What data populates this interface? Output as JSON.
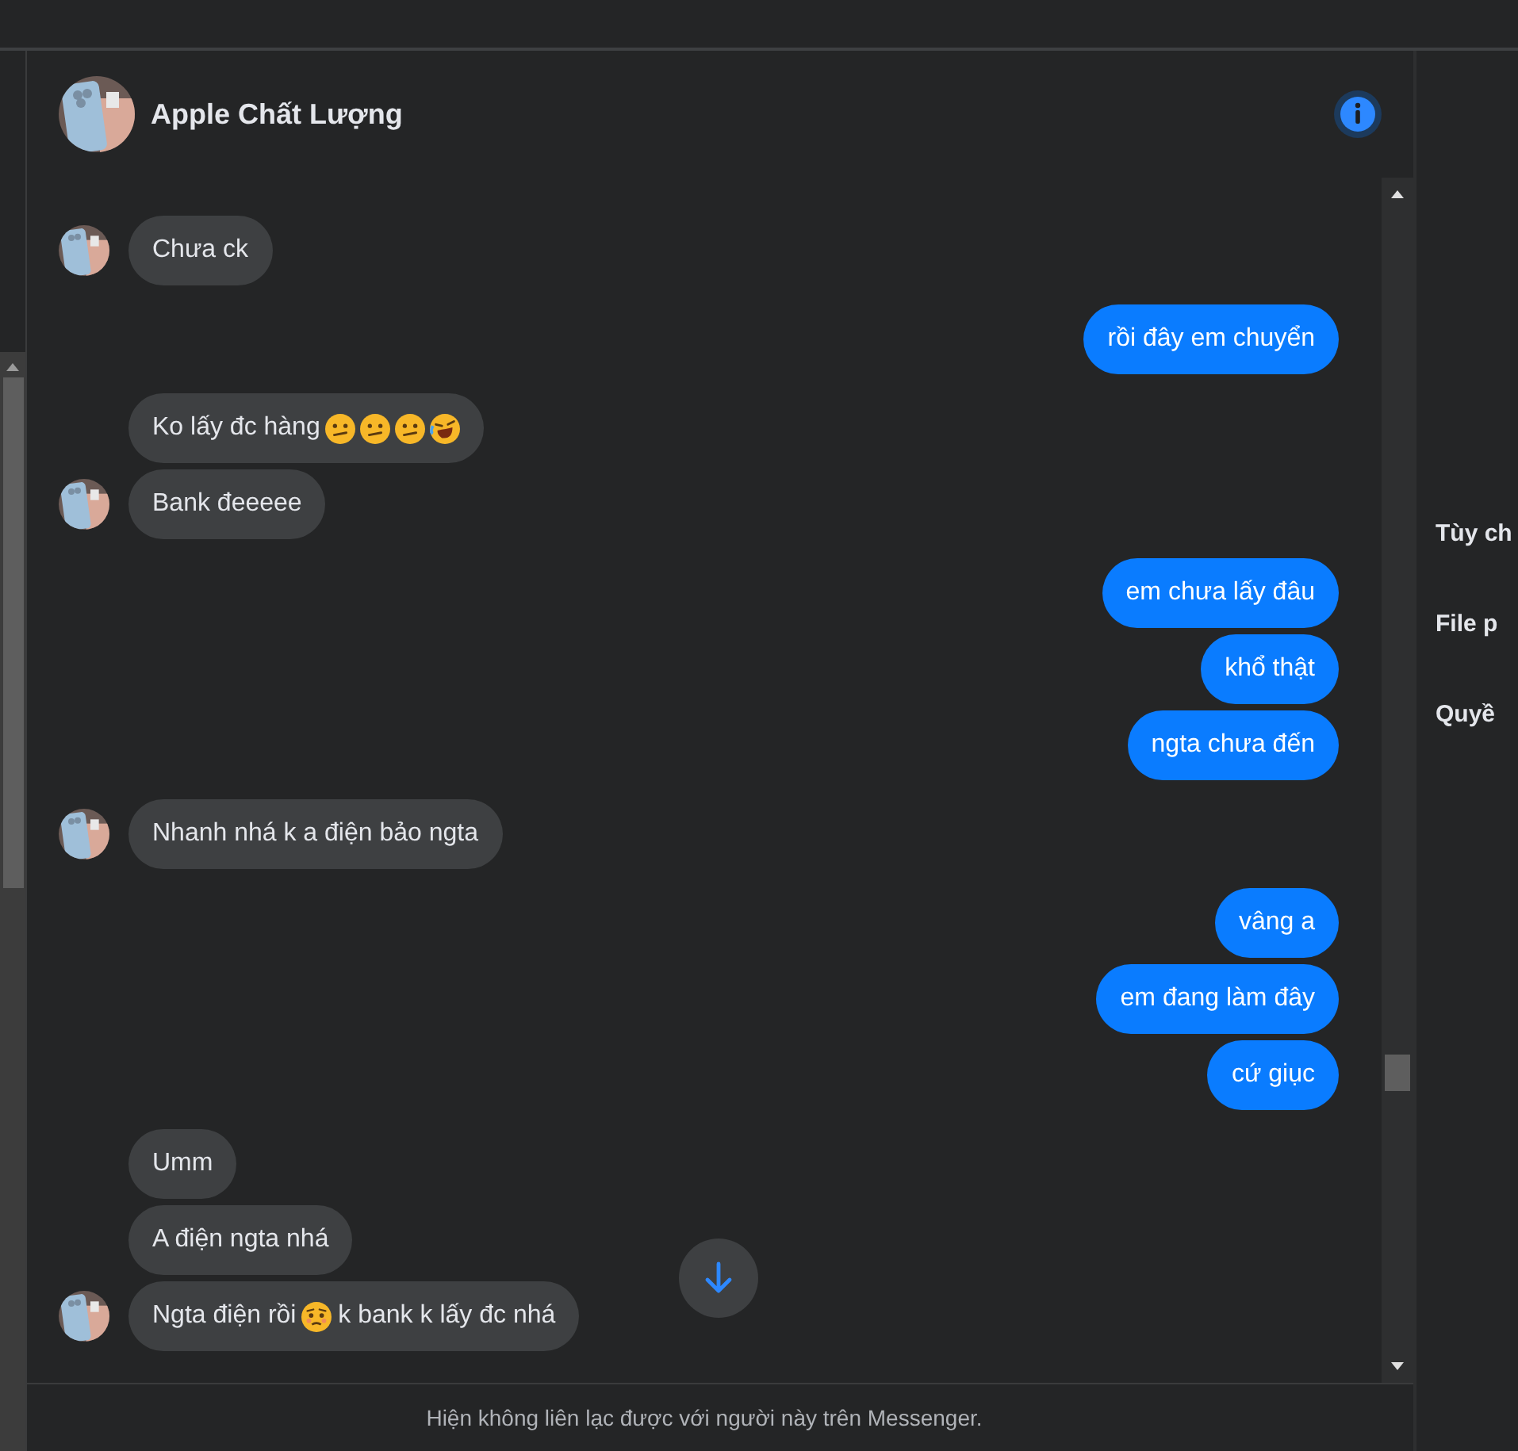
{
  "chat": {
    "title": "Apple Chất Lượng"
  },
  "messages": [
    {
      "kind": "received",
      "parts": [
        {
          "text": "Chưa ck"
        }
      ]
    },
    {
      "kind": "sent",
      "parts": [
        {
          "text": "rồi đây em chuyển"
        }
      ]
    },
    {
      "kind": "received",
      "parts": [
        {
          "text": "Ko lấy đc hàng"
        },
        {
          "kind": "confused"
        },
        {
          "kind": "confused"
        },
        {
          "kind": "confused"
        },
        {
          "kind": "laughing"
        }
      ]
    },
    {
      "kind": "received",
      "parts": [
        {
          "text": "Bank đeeeee"
        }
      ]
    },
    {
      "kind": "sent",
      "parts": [
        {
          "text": "em chưa lấy đâu"
        }
      ]
    },
    {
      "kind": "sent",
      "parts": [
        {
          "text": "khổ thật"
        }
      ]
    },
    {
      "kind": "sent",
      "parts": [
        {
          "text": "ngta chưa đến"
        }
      ]
    },
    {
      "kind": "received",
      "parts": [
        {
          "text": "Nhanh nhá k a điện bảo ngta"
        }
      ]
    },
    {
      "kind": "sent",
      "parts": [
        {
          "text": "vâng a"
        }
      ]
    },
    {
      "kind": "sent",
      "parts": [
        {
          "text": "em đang làm đây"
        }
      ]
    },
    {
      "kind": "sent",
      "parts": [
        {
          "text": "cứ giục"
        }
      ]
    },
    {
      "kind": "received",
      "parts": [
        {
          "text": "Umm"
        }
      ]
    },
    {
      "kind": "received",
      "parts": [
        {
          "text": "A điện ngta nhá"
        }
      ]
    },
    {
      "kind": "received",
      "parts": [
        {
          "text": "Ngta điện rồi"
        },
        {
          "kind": "worried"
        },
        {
          "text": " k bank k lấy đc nhá"
        }
      ]
    }
  ],
  "footer": "Hiện không liên lạc được với người này trên Messenger.",
  "side_panel": {
    "items": [
      "Tùy ch",
      "File p",
      "Quyề"
    ]
  }
}
